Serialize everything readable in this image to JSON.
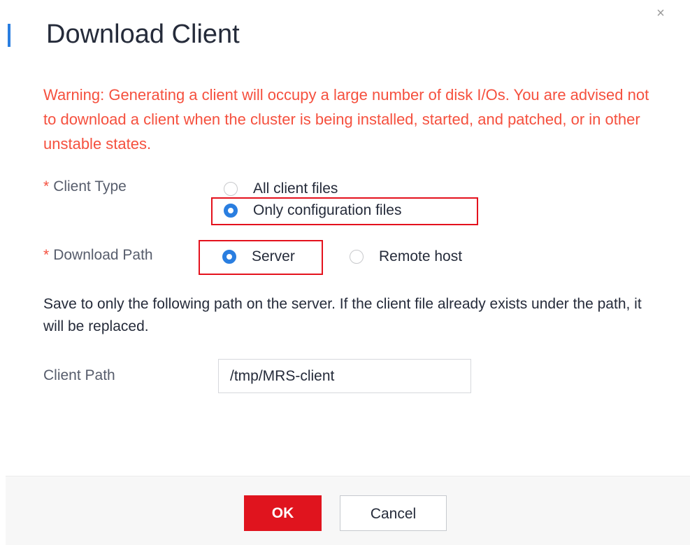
{
  "dialog": {
    "title": "Download Client",
    "close_icon": "×",
    "warning": "Warning: Generating a client will occupy a large number of disk I/Os. You are advised not to download a client when the cluster is being installed, started, and patched, or in other unstable states."
  },
  "client_type": {
    "required_mark": "*",
    "label": "Client Type",
    "options": [
      "All client files",
      "Only configuration files"
    ],
    "selected": "Only configuration files"
  },
  "download_path": {
    "required_mark": "*",
    "label": "Download Path",
    "options": [
      "Server",
      "Remote host"
    ],
    "selected": "Server"
  },
  "description": "Save to only the following path on the server. If the client file already exists under the path, it will be replaced.",
  "client_path": {
    "label": "Client Path",
    "value": "/tmp/MRS-client"
  },
  "footer": {
    "ok_label": "OK",
    "cancel_label": "Cancel"
  },
  "colors": {
    "accent": "#2a7ee0",
    "warning": "#f5503e",
    "primary_button": "#e0141e",
    "highlight_box": "#e4121d"
  }
}
